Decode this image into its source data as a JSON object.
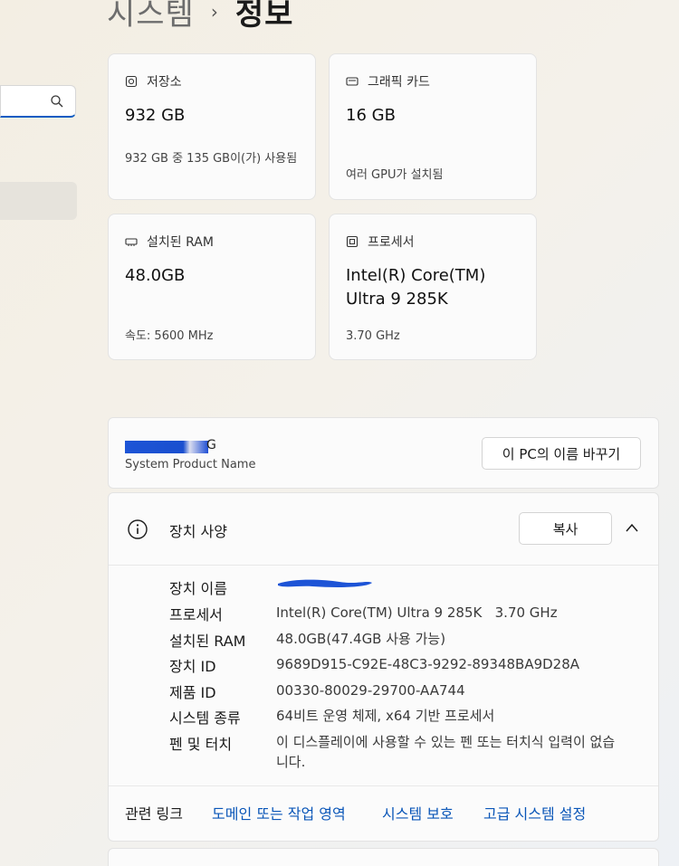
{
  "breadcrumb": {
    "parent": "시스템",
    "separator": "›",
    "current": "정보"
  },
  "cards": {
    "storage": {
      "title": "저장소",
      "value": "932 GB",
      "sub": "932 GB 중 135 GB이(가) 사용됨"
    },
    "graphics": {
      "title": "그래픽 카드",
      "value": "16 GB",
      "sub": "여러 GPU가 설치됨"
    },
    "ram": {
      "title": "설치된 RAM",
      "value": "48.0GB",
      "sub": "속도: 5600 MHz"
    },
    "processor": {
      "title": "프로세서",
      "value": "Intel(R) Core(TM) Ultra 9 285K",
      "sub": "3.70 GHz"
    }
  },
  "pc": {
    "name_visible_tail": "G",
    "subtitle": "System Product Name",
    "rename_button": "이 PC의 이름 바꾸기"
  },
  "specs": {
    "title": "장치 사양",
    "copy_button": "복사",
    "rows": [
      {
        "label": "장치 이름",
        "value": ""
      },
      {
        "label": "프로세서",
        "value": "Intel(R) Core(TM) Ultra 9 285K   3.70 GHz"
      },
      {
        "label": "설치된 RAM",
        "value": "48.0GB(47.4GB 사용 가능)"
      },
      {
        "label": "장치 ID",
        "value": "9689D915-C92E-48C3-9292-89348BA9D28A"
      },
      {
        "label": "제품 ID",
        "value": "00330-80029-29700-AA744"
      },
      {
        "label": "시스템 종류",
        "value": "64비트 운영 체제, x64 기반 프로세서"
      },
      {
        "label": "펜 및 터치",
        "value": "이 디스플레이에 사용할 수 있는 펜 또는 터치식 입력이 없습니다."
      }
    ]
  },
  "related": {
    "label": "관련 링크",
    "links": [
      "도메인 또는 작업 영역",
      "시스템 보호",
      "고급 시스템 설정"
    ]
  },
  "colors": {
    "accent": "#0a56b8",
    "redaction": "#1d54d6"
  }
}
